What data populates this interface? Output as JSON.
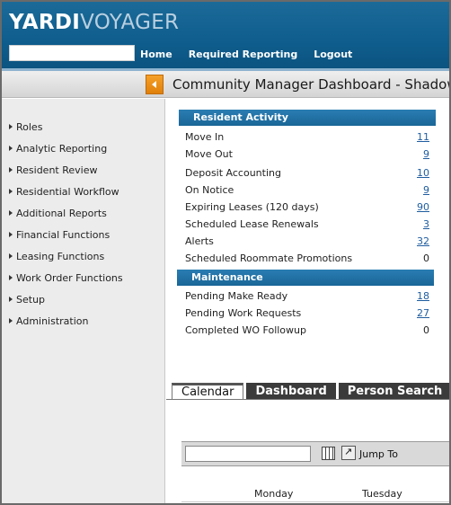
{
  "header": {
    "logo_primary": "YARDI",
    "logo_secondary": "VOYAGER",
    "search_value": "",
    "nav": [
      "Home",
      "Required Reporting",
      "Logout"
    ]
  },
  "title": "Community Manager Dashboard - Shadow",
  "sidebar": {
    "items": [
      {
        "label": "Roles"
      },
      {
        "label": "Analytic Reporting"
      },
      {
        "label": "Resident Review"
      },
      {
        "label": "Residential Workflow"
      },
      {
        "label": "Additional Reports"
      },
      {
        "label": "Financial Functions"
      },
      {
        "label": "Leasing Functions"
      },
      {
        "label": "Work Order Functions"
      },
      {
        "label": "Setup"
      },
      {
        "label": "Administration"
      }
    ]
  },
  "resident_activity": {
    "header": "Resident Activity",
    "rows": [
      {
        "label": "Move In",
        "value": "11",
        "link": true
      },
      {
        "label": "Move Out",
        "value": "9",
        "link": true
      },
      {
        "label": "Deposit Accounting",
        "value": "10",
        "link": true
      },
      {
        "label": "On Notice",
        "value": "9",
        "link": true
      },
      {
        "label": "Expiring Leases (120 days)",
        "value": "90",
        "link": true
      },
      {
        "label": "Scheduled Lease Renewals",
        "value": "3",
        "link": true
      },
      {
        "label": "Alerts",
        "value": "32",
        "link": true
      },
      {
        "label": "Scheduled Roommate Promotions",
        "value": "0",
        "link": false
      }
    ]
  },
  "maintenance": {
    "header": "Maintenance",
    "rows": [
      {
        "label": "Pending Make Ready",
        "value": "18",
        "link": true
      },
      {
        "label": "Pending Work Requests",
        "value": "27",
        "link": true
      },
      {
        "label": "Completed WO Followup",
        "value": "0",
        "link": false
      }
    ]
  },
  "tabs": [
    "Calendar",
    "Dashboard",
    "Person Search"
  ],
  "calendar": {
    "date_value": "",
    "jump_label": "Jump To",
    "days": [
      "Monday",
      "Tuesday"
    ]
  },
  "colors": {
    "header_blue": "#0f5e8e",
    "section_blue": "#1a6697",
    "link_blue": "#1f5da0",
    "collapse_orange": "#e0800a"
  }
}
